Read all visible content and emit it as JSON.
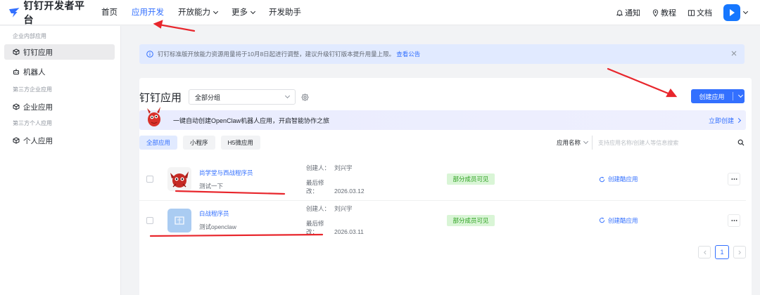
{
  "header": {
    "brand": "钉钉",
    "brand_suffix": "开发者平台",
    "nav": [
      {
        "label": "首页"
      },
      {
        "label": "应用开发"
      },
      {
        "label": "开放能力"
      },
      {
        "label": "更多"
      },
      {
        "label": "开发助手"
      }
    ],
    "tools": {
      "notify": "通知",
      "tutorial": "教程",
      "docs": "文档"
    }
  },
  "sidebar": {
    "group1": "企业内部应用",
    "item_dingtalk_app": "钉钉应用",
    "item_robot": "机器人",
    "group2": "第三方企业应用",
    "item_enterprise_app": "企业应用",
    "group3": "第三方个人应用",
    "item_personal_app": "个人应用"
  },
  "notice": {
    "text": "钉钉标准版开放能力资源用量将于10月8日起进行调整，建议升级钉钉版本提升用量上限。",
    "link": "查看公告"
  },
  "main": {
    "title": "钉钉应用",
    "group_select": "全部分组",
    "create_button": "创建应用",
    "banner_text": "一键自动创建OpenClaw机器人应用，开启智能协作之旅",
    "banner_link": "立即创建",
    "tabs": [
      "全部应用",
      "小程序",
      "H5微应用"
    ],
    "search_field": "应用名称",
    "search_placeholder": "支持应用名称/创建人等信息搜索"
  },
  "apps": [
    {
      "name": "尚学堂与西战程序员",
      "desc": "测试一下",
      "creator_label": "创建人：",
      "creator": "刘兴宇",
      "modified_label": "最后修改：",
      "modified": "2026.03.12",
      "status": "部分成员可见",
      "action": "创建酷应用"
    },
    {
      "name": "白战程序员",
      "desc": "测试openclaw",
      "creator_label": "创建人：",
      "creator": "刘兴宇",
      "modified_label": "最后修改：",
      "modified": "2026.03.11",
      "status": "部分成员可见",
      "action": "创建酷应用"
    }
  ],
  "pagination": {
    "current": "1"
  },
  "colors": {
    "accent": "#3370ff",
    "status_green": "#2ea121",
    "annotation_red": "#e8262c"
  }
}
